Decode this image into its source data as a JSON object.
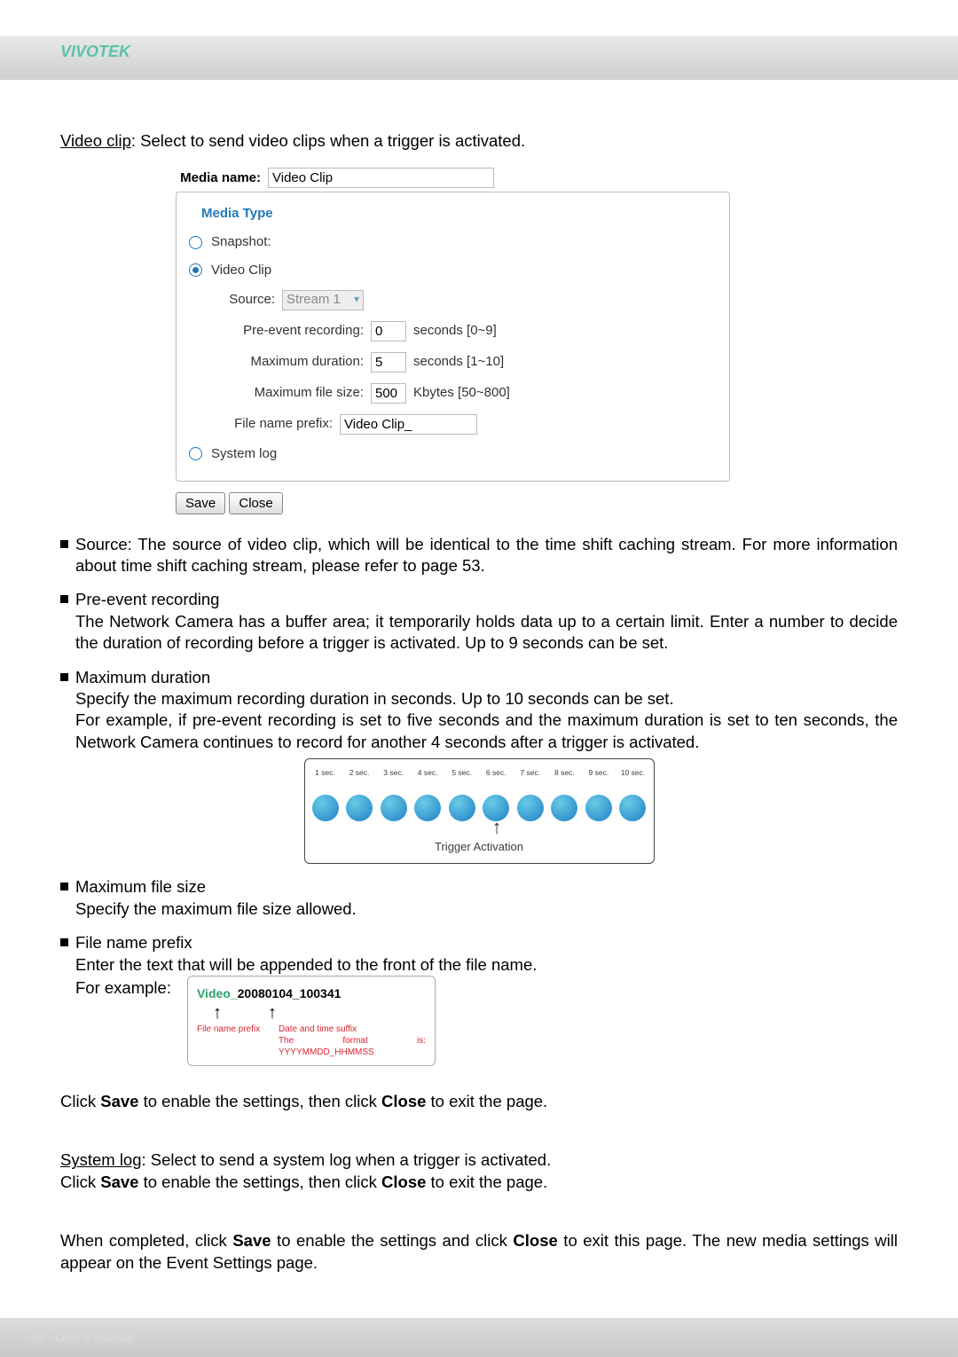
{
  "header": {
    "brand": "VIVOTEK"
  },
  "intro": {
    "label": "Video clip",
    "text": ": Select to send video clips when a trigger is activated."
  },
  "panel": {
    "media_name_label": "Media name:",
    "media_name_value": "Video Clip",
    "fieldset_legend": "Media Type",
    "r_snapshot": "Snapshot:",
    "r_videoclip": "Video Clip",
    "r_syslog": "System log",
    "source_label": "Source:",
    "source_value": "Stream 1",
    "pre_label": "Pre-event recording:",
    "pre_value": "0",
    "pre_suffix": "seconds [0~9]",
    "dur_label": "Maximum duration:",
    "dur_value": "5",
    "dur_suffix": "seconds [1~10]",
    "max_label": "Maximum file size:",
    "max_value": "500",
    "max_suffix": "Kbytes [50~800]",
    "prefix_label": "File name prefix:",
    "prefix_value": "Video Clip_",
    "btn_save": "Save",
    "btn_close": "Close"
  },
  "bullets": {
    "source": "Source: The source of video clip, which will be identical to the time shift caching stream. For more information about time shift caching stream, please refer to page 53.",
    "pre_h": "Pre-event recording",
    "pre_b": "The Network Camera has a buffer area; it temporarily holds data up to a certain limit. Enter a number to decide the duration of recording before a trigger is activated. Up to 9 seconds can be set.",
    "dur_h": "Maximum duration",
    "dur_b1": "Specify the maximum recording duration in seconds. Up to 10 seconds can be set.",
    "dur_b2": "For example, if pre-event recording is set to five seconds and the maximum duration is set to ten seconds, the Network Camera continues to record for another 4 seconds after a trigger is activated.",
    "fs_h": "Maximum file size",
    "fs_b": "Specify the maximum file size allowed.",
    "pfx_h": "File name prefix",
    "pfx_b1": "Enter the text that will be appended to the front of the file name.",
    "pfx_b2": "For example:"
  },
  "diag1": {
    "labels": [
      "1 sec.",
      "2 sec.",
      "3 sec.",
      "4 sec.",
      "5 sec.",
      "6 sec.",
      "7 sec.",
      "8 sec.",
      "9 sec.",
      "10 sec."
    ],
    "arrow": "↑",
    "caption": "Trigger Activation"
  },
  "diag2": {
    "greenprefix": "Video_",
    "rest": "20080104_100341",
    "arrow": "↑",
    "l1": "File name prefix",
    "l2a": "Date and time suffix",
    "l2b": "The format is: YYYYMMDD_HHMMSS"
  },
  "after": {
    "p1a": "Click ",
    "p1b": "Save",
    "p1c": " to enable the settings, then click ",
    "p1d": "Close",
    "p1e": " to exit the page.",
    "p2a": "System log",
    "p2b": ": Select to send a system log when a trigger is activated.",
    "p3": "When completed, click Save to enable the settings and click Close to exit this page. The new media settings will appear on the Event Settings page.",
    "p3a": "When completed, click ",
    "p3b": "Save",
    "p3c": " to enable the settings and click ",
    "p3d": "Close",
    "p3e": " to exit this page. The new media settings will appear on the Event Settings page."
  },
  "footer": {
    "text": "90 - User's Manual"
  },
  "chart_data": {
    "type": "bar",
    "categories": [
      "1 sec.",
      "2 sec.",
      "3 sec.",
      "4 sec.",
      "5 sec.",
      "6 sec.",
      "7 sec.",
      "8 sec.",
      "9 sec.",
      "10 sec."
    ],
    "values": [
      1,
      1,
      1,
      1,
      1,
      1,
      1,
      1,
      1,
      1
    ],
    "title": "Trigger Activation",
    "xlabel": "",
    "ylabel": "",
    "ylim": [
      0,
      1
    ],
    "annotation": "Trigger at 6 sec."
  }
}
